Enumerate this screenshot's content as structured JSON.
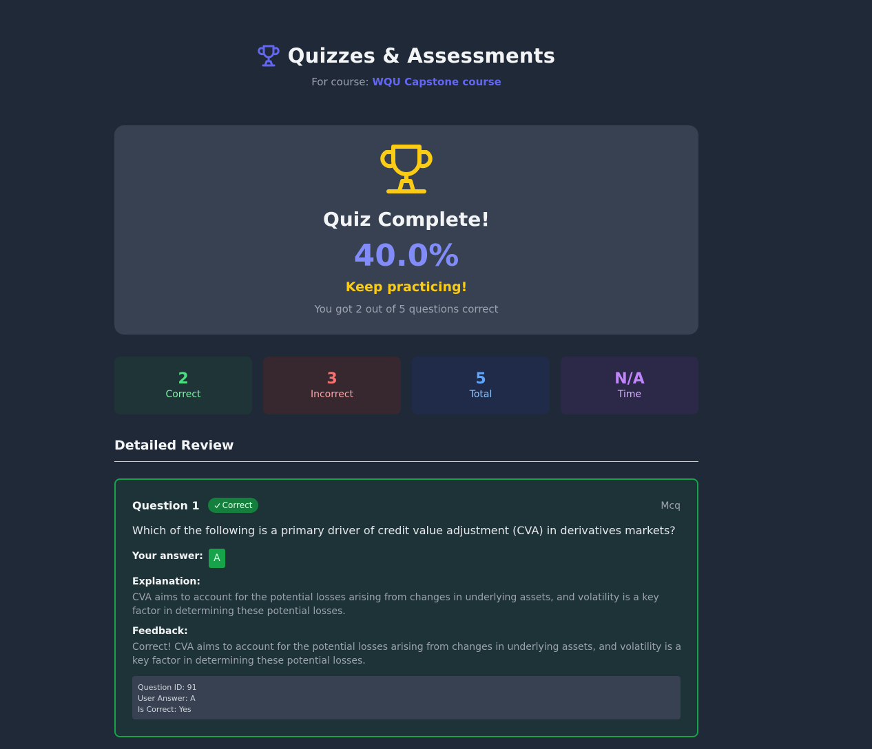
{
  "header": {
    "title": "Quizzes & Assessments",
    "course_prefix": "For course:",
    "course_name": "WQU Capstone course"
  },
  "result": {
    "heading": "Quiz Complete!",
    "score": "40.0%",
    "message": "Keep practicing!",
    "summary": "You got 2 out of 5 questions correct"
  },
  "stats": {
    "correct": {
      "value": "2",
      "label": "Correct"
    },
    "incorrect": {
      "value": "3",
      "label": "Incorrect"
    },
    "total": {
      "value": "5",
      "label": "Total"
    },
    "time": {
      "value": "N/A",
      "label": "Time"
    }
  },
  "review": {
    "heading": "Detailed Review",
    "questions": [
      {
        "title": "Question 1",
        "badge": "Correct",
        "type": "Mcq",
        "text": "Which of the following is a primary driver of credit value adjustment (CVA) in derivatives markets?",
        "answer_label": "Your answer:",
        "answer": "A",
        "explanation_label": "Explanation:",
        "explanation": "CVA aims to account for the potential losses arising from changes in underlying assets, and volatility is a key factor in determining these potential losses.",
        "feedback_label": "Feedback:",
        "feedback": "Correct! CVA aims to account for the potential losses arising from changes in underlying assets, and volatility is a key factor in determining these potential losses.",
        "meta": {
          "question_id": "Question ID: 91",
          "user_answer": "User Answer: A",
          "is_correct": "Is Correct: Yes"
        }
      }
    ]
  },
  "colors": {
    "background": "#1f2937",
    "accent": "#6366f1",
    "trophy": "#facc15",
    "success": "#16a34a"
  }
}
